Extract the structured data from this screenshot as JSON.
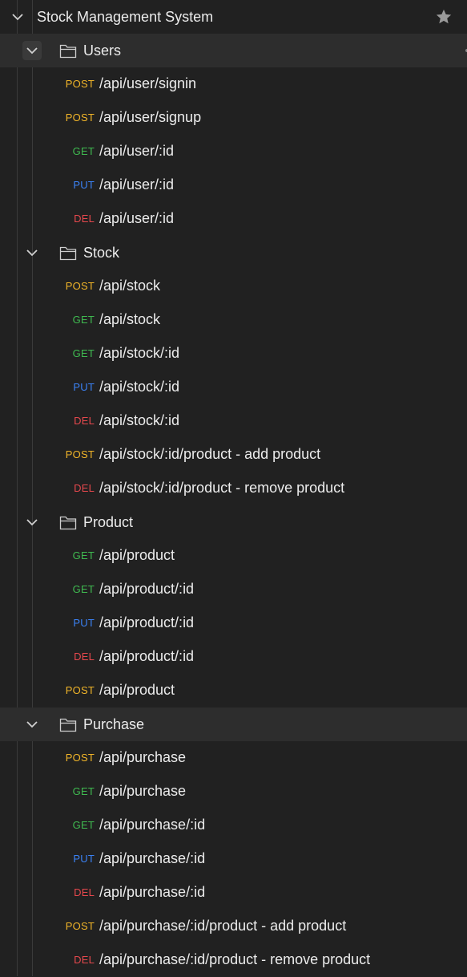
{
  "collection": {
    "title": "Stock Management System",
    "star_icon": "star-icon"
  },
  "colors": {
    "background": "#212121",
    "post": "#f0b429",
    "get": "#3fb950",
    "put": "#3b82f6",
    "del": "#e5484d"
  },
  "folders": [
    {
      "label": "Users",
      "requests": [
        {
          "method": "POST",
          "path": "/api/user/signin"
        },
        {
          "method": "POST",
          "path": "/api/user/signup"
        },
        {
          "method": "GET",
          "path": "/api/user/:id"
        },
        {
          "method": "PUT",
          "path": "/api/user/:id"
        },
        {
          "method": "DEL",
          "path": "/api/user/:id"
        }
      ]
    },
    {
      "label": "Stock",
      "requests": [
        {
          "method": "POST",
          "path": "/api/stock"
        },
        {
          "method": "GET",
          "path": "/api/stock"
        },
        {
          "method": "GET",
          "path": "/api/stock/:id"
        },
        {
          "method": "PUT",
          "path": "/api/stock/:id"
        },
        {
          "method": "DEL",
          "path": "/api/stock/:id"
        },
        {
          "method": "POST",
          "path": "/api/stock/:id/product - add product"
        },
        {
          "method": "DEL",
          "path": "/api/stock/:id/product - remove product"
        }
      ]
    },
    {
      "label": "Product",
      "requests": [
        {
          "method": "GET",
          "path": "/api/product"
        },
        {
          "method": "GET",
          "path": "/api/product/:id"
        },
        {
          "method": "PUT",
          "path": "/api/product/:id"
        },
        {
          "method": "DEL",
          "path": "/api/product/:id"
        },
        {
          "method": "POST",
          "path": "/api/product"
        }
      ]
    },
    {
      "label": "Purchase",
      "requests": [
        {
          "method": "POST",
          "path": "/api/purchase"
        },
        {
          "method": "GET",
          "path": "/api/purchase"
        },
        {
          "method": "GET",
          "path": "/api/purchase/:id"
        },
        {
          "method": "PUT",
          "path": "/api/purchase/:id"
        },
        {
          "method": "DEL",
          "path": "/api/purchase/:id"
        },
        {
          "method": "POST",
          "path": "/api/purchase/:id/product - add product"
        },
        {
          "method": "DEL",
          "path": "/api/purchase/:id/product - remove product"
        }
      ]
    }
  ]
}
